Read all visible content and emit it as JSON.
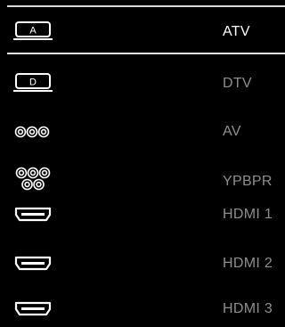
{
  "sources": [
    {
      "id": "atv",
      "label": "ATV",
      "icon": "tv-a-icon",
      "selected": true
    },
    {
      "id": "dtv",
      "label": "DTV",
      "icon": "tv-d-icon",
      "selected": false
    },
    {
      "id": "av",
      "label": "AV",
      "icon": "av-rca-icon",
      "selected": false
    },
    {
      "id": "ypbpr",
      "label": "YPBPR",
      "icon": "component-rca-icon",
      "selected": false
    },
    {
      "id": "hdmi1",
      "label": "HDMI 1",
      "icon": "hdmi-port-icon",
      "selected": false
    },
    {
      "id": "hdmi2",
      "label": "HDMI 2",
      "icon": "hdmi-port-icon",
      "selected": false
    },
    {
      "id": "hdmi3",
      "label": "HDMI 3",
      "icon": "hdmi-port-icon",
      "selected": false
    }
  ],
  "icon_letters": {
    "atv": "A",
    "dtv": "D"
  },
  "colors": {
    "selected_text": "#ffffff",
    "unselected_text": "#8e8e8e",
    "icon": "#ffffff",
    "background": "#000000"
  }
}
